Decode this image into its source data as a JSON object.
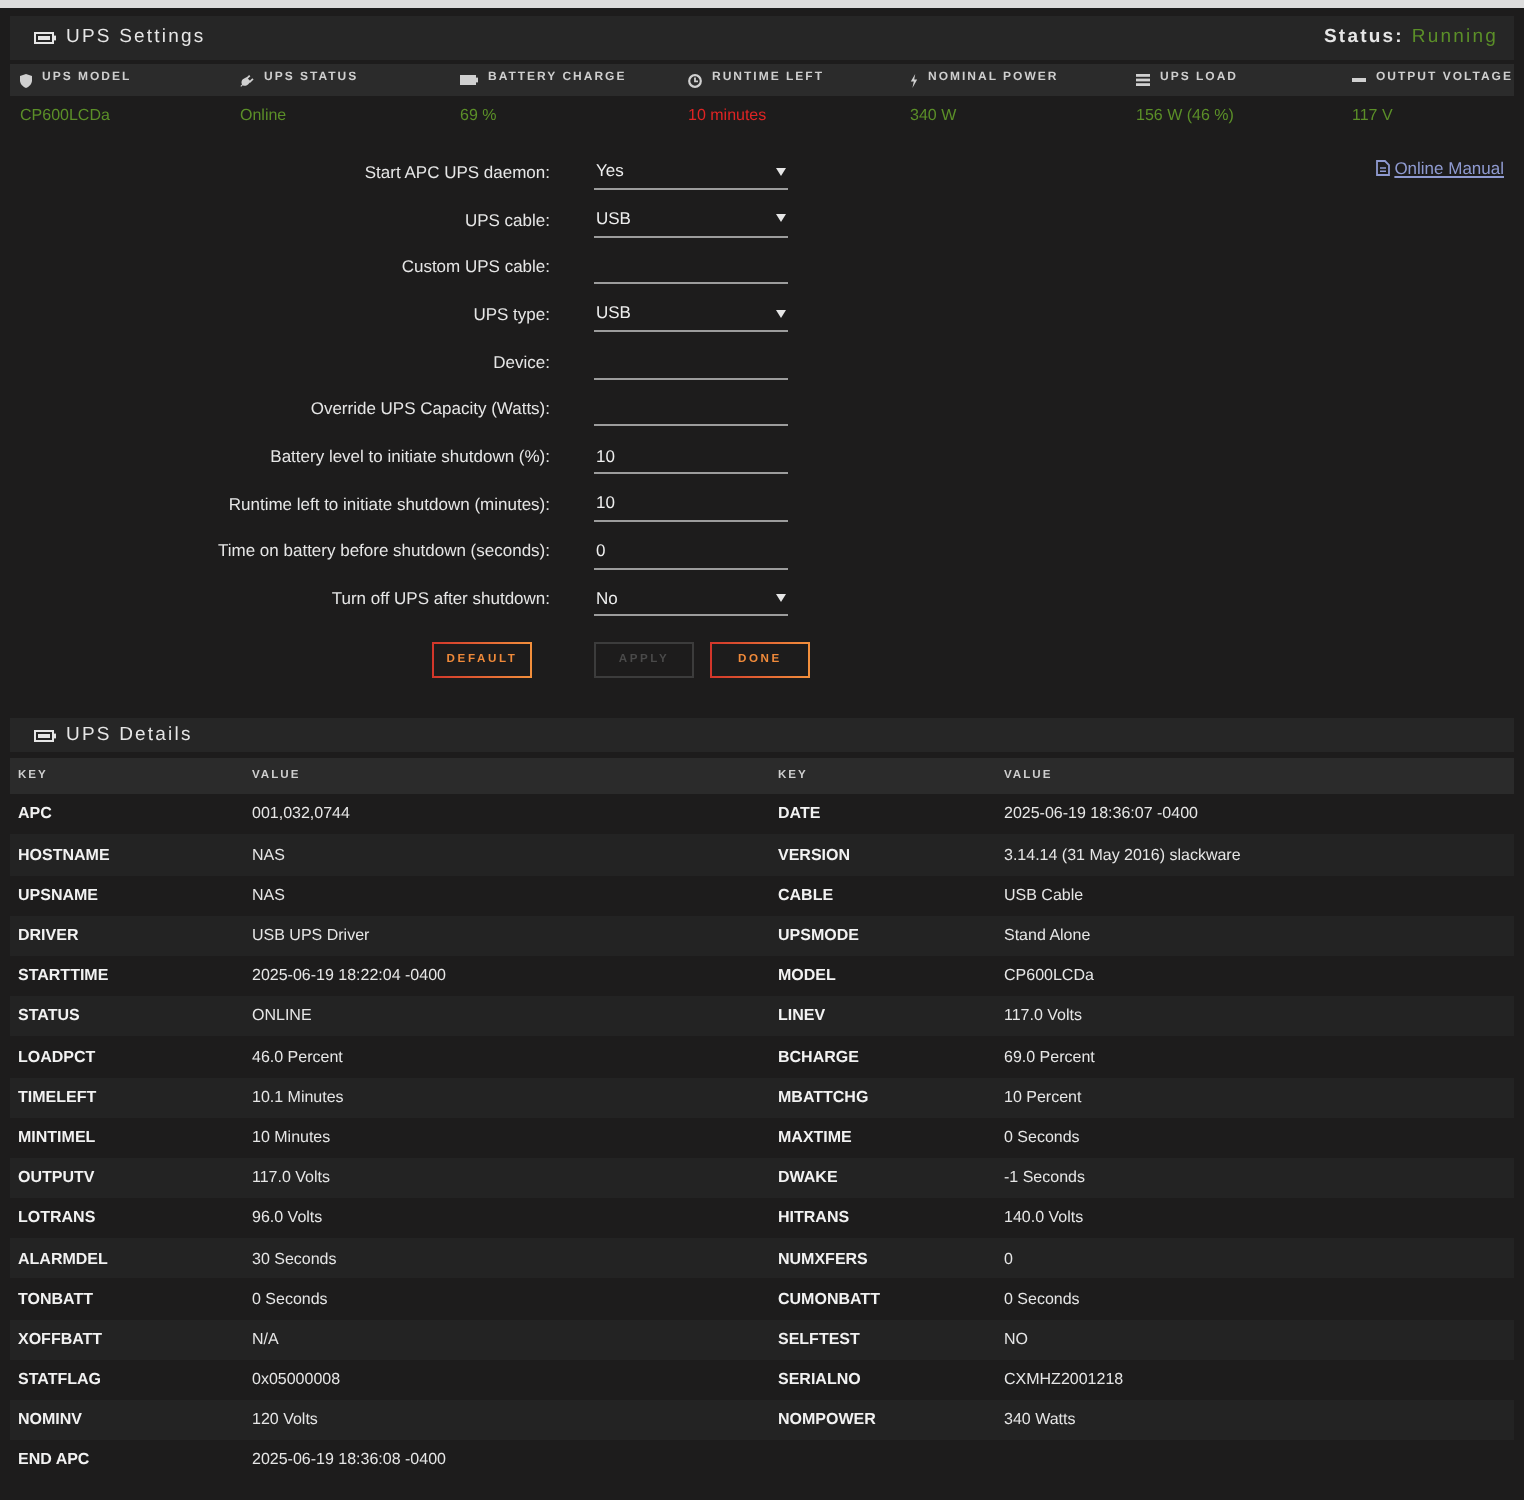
{
  "settings": {
    "title": "UPS Settings",
    "status_label": "Status:",
    "status_value": "Running"
  },
  "summary": [
    {
      "kind": "model",
      "label": "UPS MODEL",
      "value": "CP600LCDa",
      "color": "#5b8f28"
    },
    {
      "kind": "status",
      "label": "UPS STATUS",
      "value": "Online",
      "color": "#5b8f28"
    },
    {
      "kind": "battery",
      "label": "BATTERY CHARGE",
      "value": "69 %",
      "color": "#5b8f28"
    },
    {
      "kind": "runtime",
      "label": "RUNTIME LEFT",
      "value": "10 minutes",
      "color": "#e02424"
    },
    {
      "kind": "power",
      "label": "NOMINAL POWER",
      "value": "340 W",
      "color": "#5b8f28"
    },
    {
      "kind": "load",
      "label": "UPS LOAD",
      "value": "156 W (46 %)",
      "color": "#5b8f28"
    },
    {
      "kind": "voltage",
      "label": "OUTPUT VOLTAGE",
      "value": "117 V",
      "color": "#5b8f28"
    }
  ],
  "form": {
    "fields": [
      {
        "kind": "select",
        "label": "Start APC UPS daemon:",
        "value": "Yes"
      },
      {
        "kind": "select",
        "label": "UPS cable:",
        "value": "USB"
      },
      {
        "kind": "input",
        "label": "Custom UPS cable:"
      },
      {
        "kind": "select",
        "label": "UPS type:",
        "value": "USB"
      },
      {
        "kind": "input",
        "label": "Device:"
      },
      {
        "kind": "input",
        "label": "Override UPS Capacity (Watts):"
      },
      {
        "kind": "input",
        "label": "Battery level to initiate shutdown (%):",
        "value": "10"
      },
      {
        "kind": "input",
        "label": "Runtime left to initiate shutdown (minutes):",
        "value": "10"
      },
      {
        "kind": "input",
        "label": "Time on battery before shutdown (seconds):",
        "value": "0"
      },
      {
        "kind": "select",
        "label": "Turn off UPS after shutdown:",
        "value": "No"
      }
    ],
    "buttons": [
      {
        "label": "DEFAULT",
        "disabled": false
      },
      {
        "label": "APPLY",
        "disabled": true
      },
      {
        "label": "DONE",
        "disabled": false
      }
    ],
    "link": {
      "label": "Online Manual"
    }
  },
  "details": {
    "title": "UPS Details",
    "columns": [
      "KEY",
      "VALUE",
      "KEY",
      "VALUE"
    ],
    "rows": [
      [
        "APC",
        "001,032,0744",
        "DATE",
        "2025-06-19 18:36:07 -0400"
      ],
      [
        "HOSTNAME",
        "NAS",
        "VERSION",
        "3.14.14 (31 May 2016) slackware"
      ],
      [
        "UPSNAME",
        "NAS",
        "CABLE",
        "USB Cable"
      ],
      [
        "DRIVER",
        "USB UPS Driver",
        "UPSMODE",
        "Stand Alone"
      ],
      [
        "STARTTIME",
        "2025-06-19 18:22:04 -0400",
        "MODEL",
        "CP600LCDa"
      ],
      [
        "STATUS",
        "ONLINE",
        "LINEV",
        "117.0 Volts"
      ],
      [
        "LOADPCT",
        "46.0 Percent",
        "BCHARGE",
        "69.0 Percent"
      ],
      [
        "TIMELEFT",
        "10.1 Minutes",
        "MBATTCHG",
        "10 Percent"
      ],
      [
        "MINTIMEL",
        "10 Minutes",
        "MAXTIME",
        "0 Seconds"
      ],
      [
        "OUTPUTV",
        "117.0 Volts",
        "DWAKE",
        "-1 Seconds"
      ],
      [
        "LOTRANS",
        "96.0 Volts",
        "HITRANS",
        "140.0 Volts"
      ],
      [
        "ALARMDEL",
        "30 Seconds",
        "NUMXFERS",
        "0"
      ],
      [
        "TONBATT",
        "0 Seconds",
        "CUMONBATT",
        "0 Seconds"
      ],
      [
        "XOFFBATT",
        "N/A",
        "SELFTEST",
        "NO"
      ],
      [
        "STATFLAG",
        "0x05000008",
        "SERIALNO",
        "CXMHZ2001218"
      ],
      [
        "NOMINV",
        "120 Volts",
        "NOMPOWER",
        "340 Watts"
      ],
      [
        "END APC",
        "2025-06-19 18:36:08 -0400"
      ]
    ]
  }
}
